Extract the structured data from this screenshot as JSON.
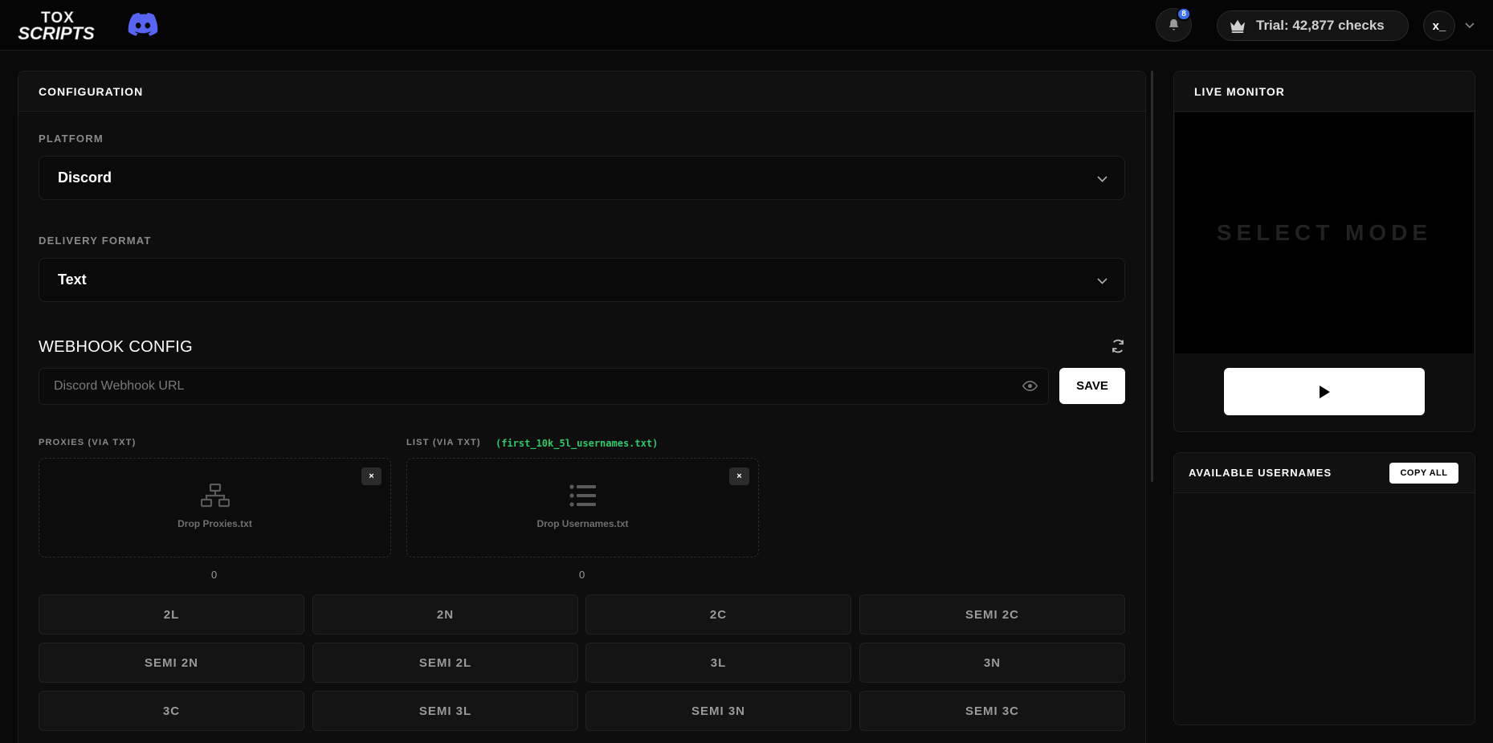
{
  "nav": {
    "logo_line1": "TOX",
    "logo_line2": "SCRIPTS",
    "notification_count": "8",
    "trial_label": "Trial: 42,877 checks",
    "user_initials": "x_"
  },
  "config": {
    "title": "CONFIGURATION",
    "platform_label": "PLATFORM",
    "platform_value": "Discord",
    "delivery_label": "DELIVERY FORMAT",
    "delivery_value": "Text",
    "webhook_title": "WEBHOOK CONFIG",
    "webhook_placeholder": "Discord Webhook URL",
    "save_label": "SAVE",
    "proxies_label": "PROXIES (VIA TXT)",
    "list_label": "LIST (VIA TXT)",
    "list_filename": "(first_10k_5l_usernames.txt)",
    "proxies_drop": "Drop Proxies.txt",
    "usernames_drop": "Drop Usernames.txt",
    "clear_symbol": "×",
    "proxies_count": "0",
    "usernames_count": "0",
    "modes": [
      "2L",
      "2N",
      "2C",
      "SEMI 2C",
      "SEMI 2N",
      "SEMI 2L",
      "3L",
      "3N",
      "3C",
      "SEMI 3L",
      "SEMI 3N",
      "SEMI 3C"
    ]
  },
  "monitor": {
    "title": "LIVE MONITOR",
    "screen_text": "SELECT MODE"
  },
  "available": {
    "title": "AVAILABLE USERNAMES",
    "copy_label": "COPY ALL"
  },
  "colors": {
    "accent_green": "#2fc86a",
    "badge_blue": "#3b6ff0",
    "discord": "#5865F2"
  }
}
